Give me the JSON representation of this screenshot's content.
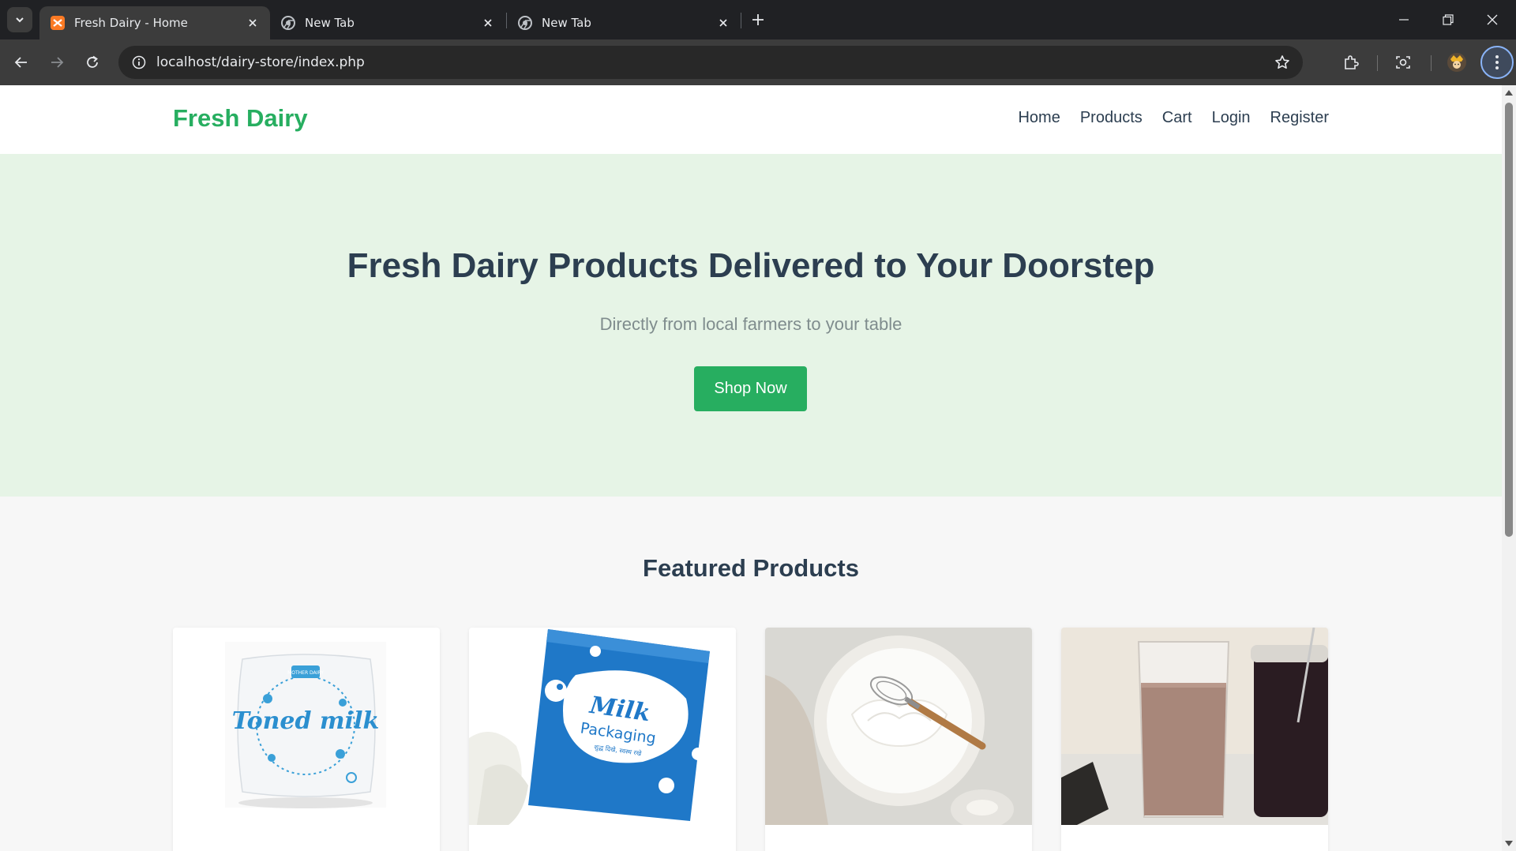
{
  "browser": {
    "tabs": [
      {
        "title": "Fresh Dairy - Home",
        "active": true
      },
      {
        "title": "New Tab",
        "active": false
      },
      {
        "title": "New Tab",
        "active": false
      }
    ],
    "url": "localhost/dairy-store/index.php"
  },
  "site": {
    "logo": "Fresh Dairy",
    "nav": [
      "Home",
      "Products",
      "Cart",
      "Login",
      "Register"
    ],
    "hero": {
      "title": "Fresh Dairy Products Delivered to Your Doorstep",
      "subtitle": "Directly from local farmers to your table",
      "cta": "Shop Now"
    },
    "featured_title": "Featured Products",
    "products": [
      {
        "image": "toned-milk-pouch",
        "brand": "MOTHER DAIRY",
        "label": "Toned milk"
      },
      {
        "image": "milk-packaging-pouch",
        "label_line1": "Milk",
        "label_line2": "Packaging",
        "tagline": "शुद्ध दिखे, स्वस्थ रखे"
      },
      {
        "image": "whipped-cream-bowl"
      },
      {
        "image": "chocolate-milk-glass"
      }
    ]
  },
  "colors": {
    "brand_green": "#27ae60",
    "hero_bg": "#e6f4e6",
    "text_dark": "#2c3e50",
    "text_muted": "#7f8c8d"
  }
}
